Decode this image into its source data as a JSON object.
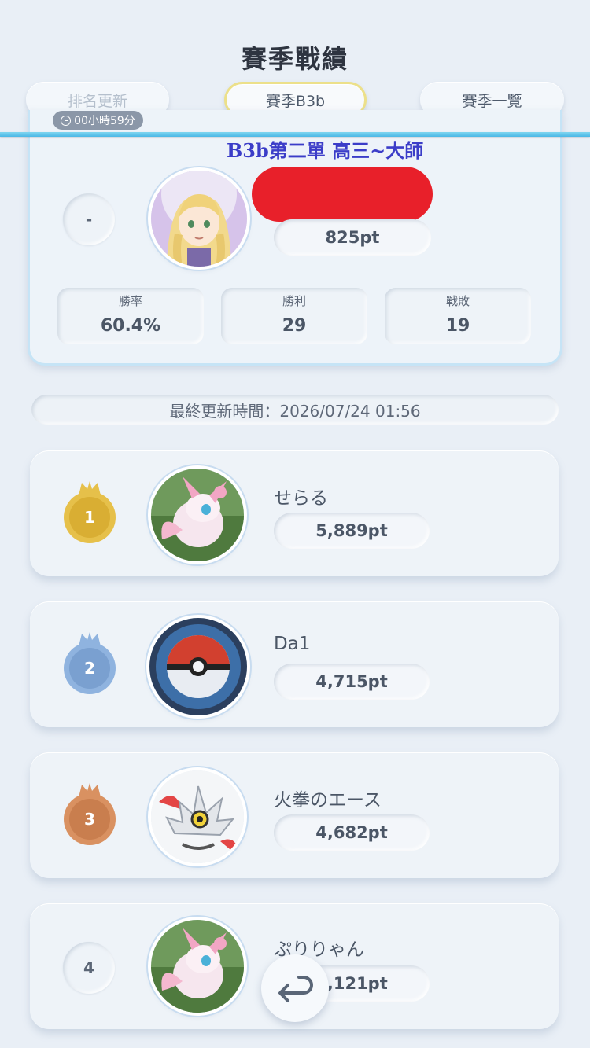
{
  "page_title": "賽季戰績",
  "header": {
    "rank_update_label": "排名更新",
    "timer": "00小時59分",
    "season_label": "賽季B3b",
    "season_list_label": "賽季一覽"
  },
  "overlay_caption": "B3b第二單 高三~大師",
  "my_record": {
    "rank": "-",
    "points": "825pt",
    "stats": [
      {
        "label": "勝率",
        "value": "60.4%"
      },
      {
        "label": "勝利",
        "value": "29"
      },
      {
        "label": "戰敗",
        "value": "19"
      }
    ]
  },
  "last_updated": "最終更新時間：2026/07/24 01:56",
  "rankings": [
    {
      "rank": "1",
      "name": "せらる",
      "points": "5,889pt",
      "medal": "gold",
      "avatar": "sylveon"
    },
    {
      "rank": "2",
      "name": "Da1",
      "points": "4,715pt",
      "medal": "silver",
      "avatar": "pokeball"
    },
    {
      "rank": "3",
      "name": "火拳のエース",
      "points": "4,682pt",
      "medal": "bronze",
      "avatar": "white-pokemon"
    },
    {
      "rank": "4",
      "name": "ぷりりゃん",
      "points": "4,121pt",
      "medal": "none",
      "avatar": "sylveon"
    }
  ],
  "colors": {
    "gold": "#e6c04a",
    "silver": "#8fb3df",
    "bronze": "#d99161",
    "divider": "#5cc3ea",
    "overlay_text": "#3b3dc8",
    "redaction": "#e8202a"
  }
}
